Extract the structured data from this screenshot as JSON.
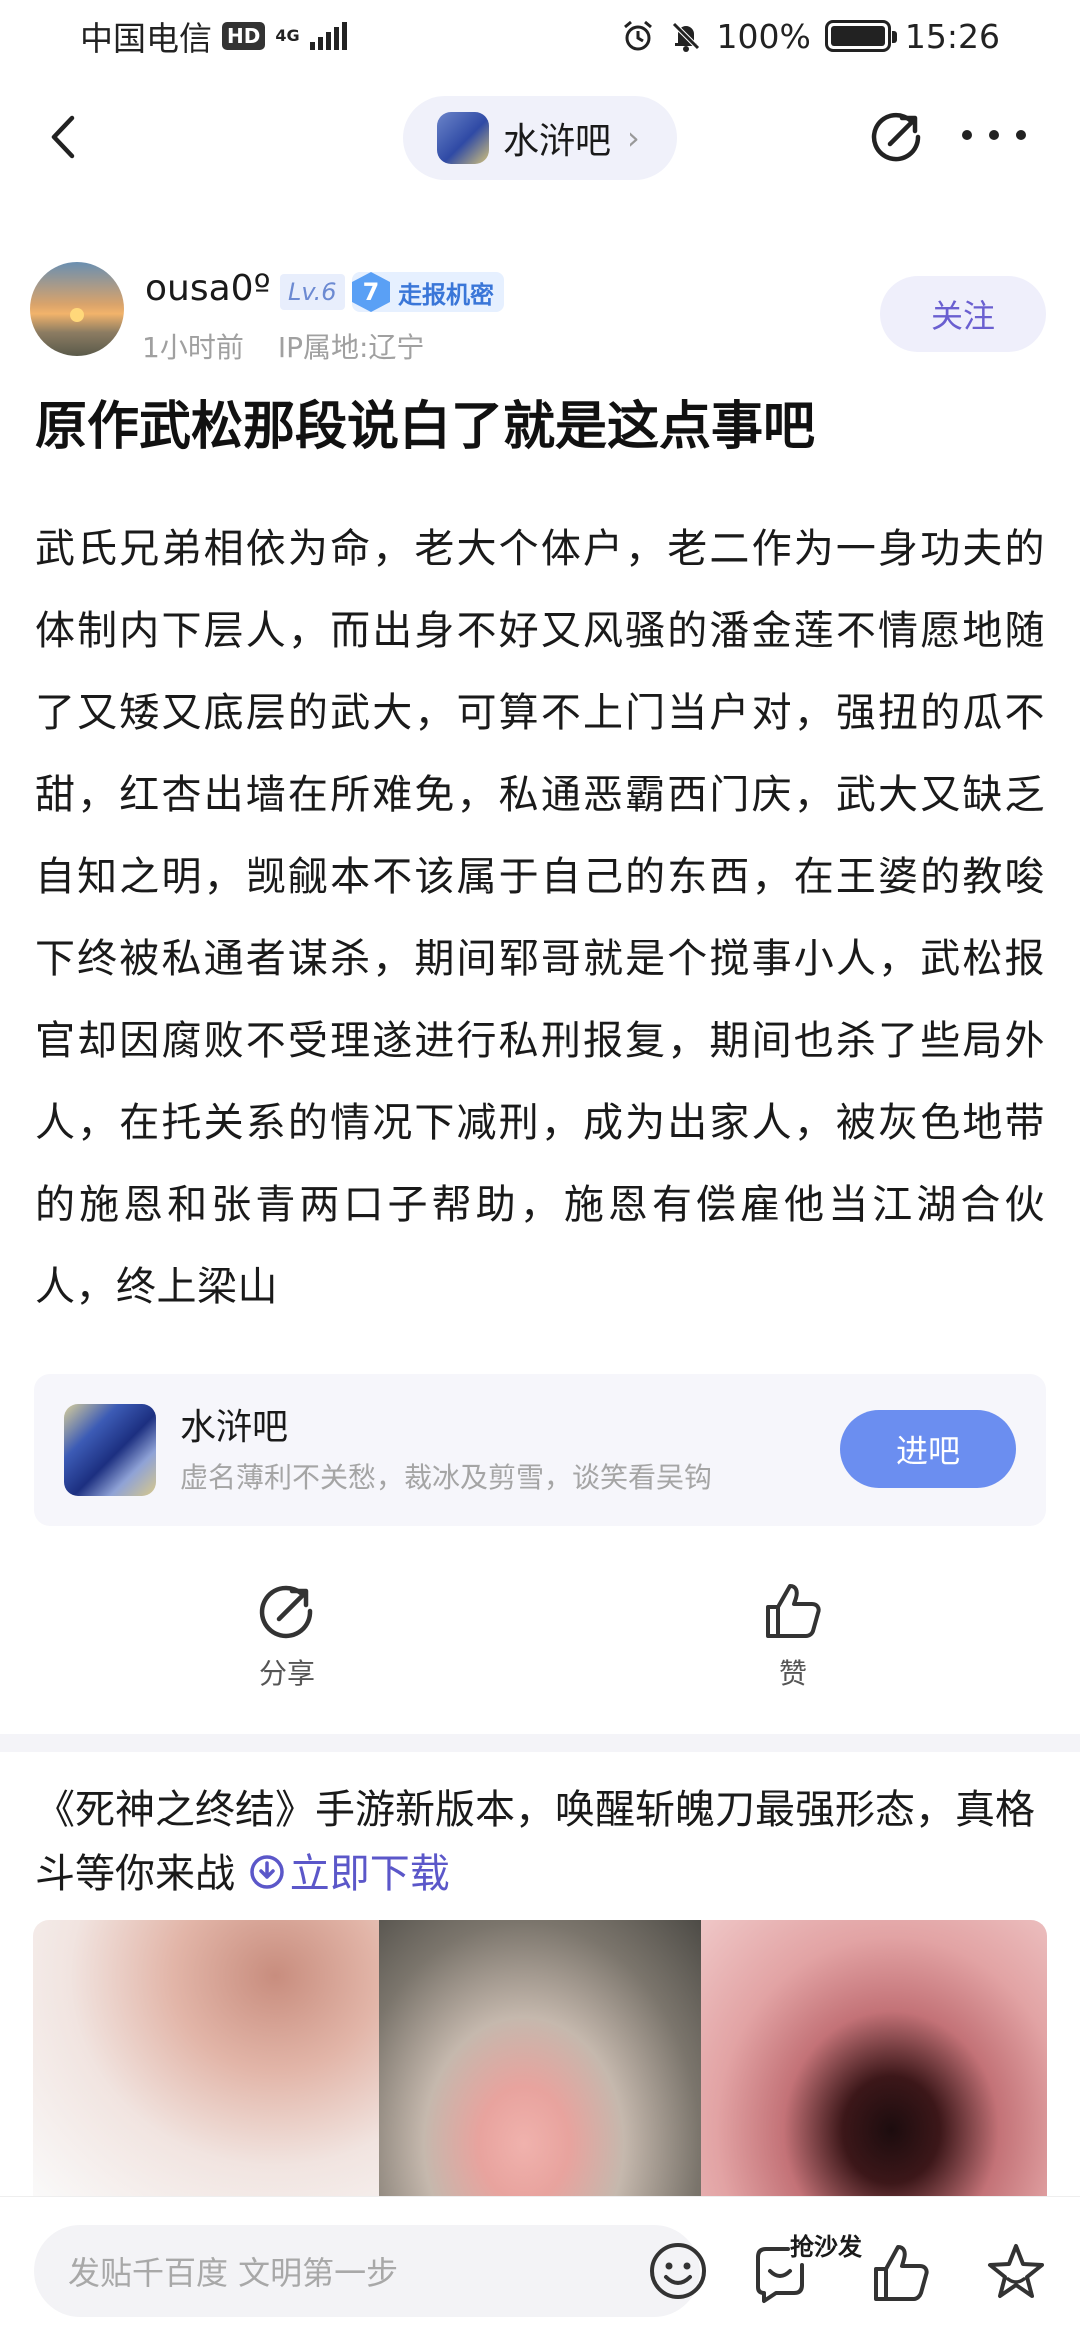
{
  "status_bar": {
    "carrier": "中国电信",
    "hd": "HD",
    "network": "4G",
    "battery_percent": "100%",
    "battery_level": 1.0,
    "time": "15:26",
    "icons": [
      "alarm-icon",
      "mute-bell-icon",
      "battery-icon"
    ]
  },
  "nav": {
    "forum_name": "水浒吧",
    "chevron": "›",
    "icons": [
      "back-icon",
      "share-icon",
      "more-icon"
    ]
  },
  "author": {
    "name": "ousa0º",
    "level": "Lv.6",
    "title_level": "7",
    "title": "走报机密",
    "time": "1小时前",
    "ip": "IP属地:辽宁",
    "follow_label": "关注"
  },
  "post": {
    "title": "原作武松那段说白了就是这点事吧",
    "body": "武氏兄弟相依为命，老大个体户，老二作为一身功夫的体制内下层人，而出身不好又风骚的潘金莲不情愿地随了又矮又底层的武大，可算不上门当户对，强扭的瓜不甜，红杏出墙在所难免，私通恶霸西门庆，武大又缺乏自知之明，觊觎本不该属于自己的东西，在王婆的教唆下终被私通者谋杀，期间郓哥就是个搅事小人，武松报官却因腐败不受理遂进行私刑报复，期间也杀了些局外人，在托关系的情况下减刑，成为出家人，被灰色地带的施恩和张青两口子帮助，施恩有偿雇他当江湖合伙人，终上梁山"
  },
  "forum_card": {
    "name": "水浒吧",
    "slogan": "虚名薄利不关愁，裁冰及剪雪，谈笑看吴钩",
    "enter_label": "进吧"
  },
  "actions": {
    "share_label": "分享",
    "like_label": "赞"
  },
  "ad": {
    "text": "《死神之终结》手游新版本，唤醒斩魄刀最强形态，真格斗等你来战",
    "link_label": "立即下载",
    "accent": "#5b57c9"
  },
  "bottom_bar": {
    "placeholder": "发贴千百度 文明第一步",
    "sofa_label": "抢沙发",
    "icons": [
      "emoji-icon",
      "comment-icon",
      "like-icon",
      "star-icon"
    ]
  },
  "colors": {
    "primary_button": "#6b8ef0",
    "follow_text": "#6a5fd0",
    "meta_text": "#a0a0a0"
  }
}
